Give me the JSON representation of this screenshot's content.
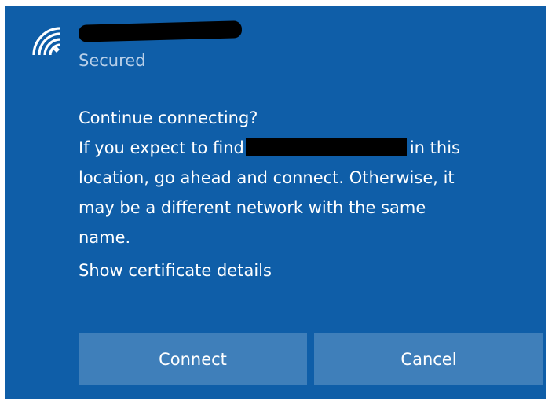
{
  "network": {
    "icon": "wifi-secured-icon",
    "status": "Secured"
  },
  "message": {
    "question": "Continue connecting?",
    "line1_before": "If you expect to find",
    "line1_after": "in this",
    "line2": "location, go ahead and connect. Otherwise, it",
    "line3": "may be a different network with the same",
    "line4": "name."
  },
  "links": {
    "certificate": "Show certificate details"
  },
  "buttons": {
    "connect": "Connect",
    "cancel": "Cancel"
  },
  "colors": {
    "panel_background": "#0f5ea8",
    "button_background": "#3f7fba",
    "secondary_text": "#b8cfe8"
  }
}
